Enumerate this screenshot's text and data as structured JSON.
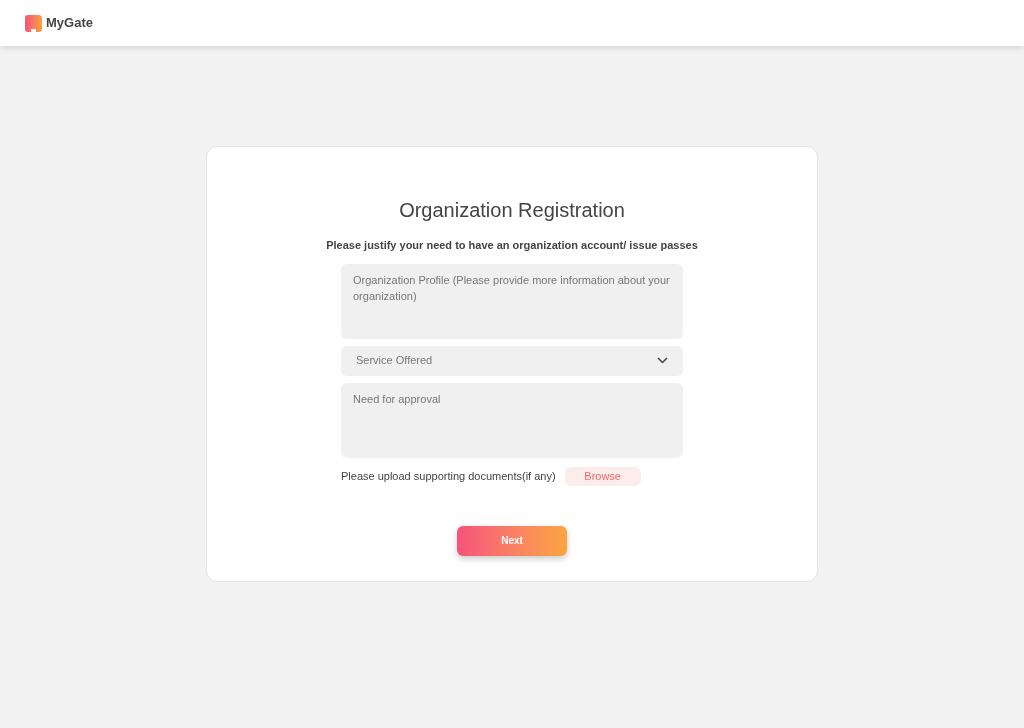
{
  "header": {
    "brand": "MyGate"
  },
  "form": {
    "title": "Organization Registration",
    "subtitle": "Please justify your need to have an organization account/ issue passes",
    "fields": [
      {
        "kind": "textarea",
        "placeholder": "Organization Profile (Please provide more information about your organization)"
      },
      {
        "kind": "select",
        "placeholder": "Service Offered"
      },
      {
        "kind": "textarea",
        "placeholder": "Need for approval"
      }
    ],
    "upload_label": "Please upload supporting documents(if any)",
    "browse_button": "Browse",
    "next_button": "Next"
  }
}
